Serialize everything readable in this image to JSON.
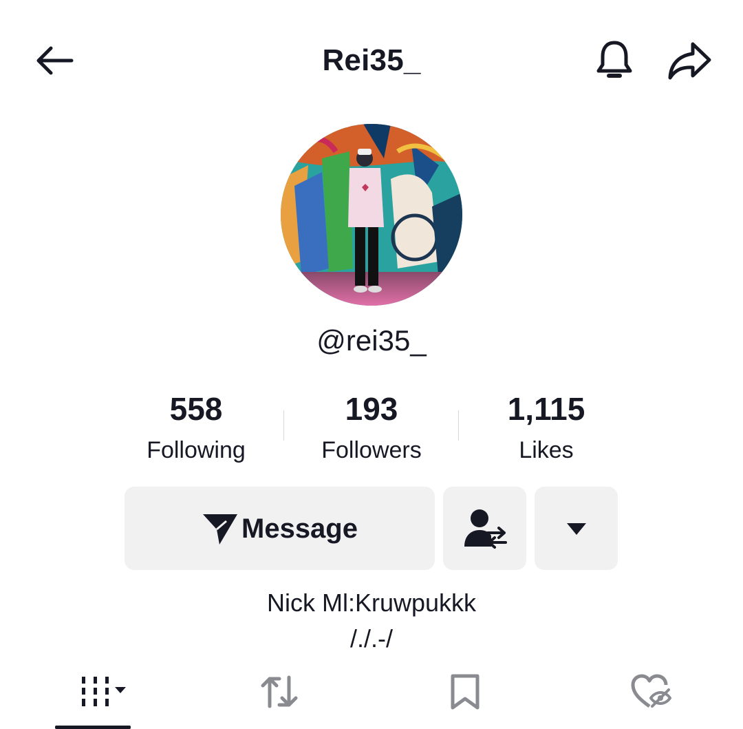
{
  "header": {
    "title": "Rei35_",
    "back_icon": "arrow-left-icon",
    "bell_icon": "bell-icon",
    "share_icon": "share-icon"
  },
  "profile": {
    "avatar": "profile-photo",
    "username": "@rei35_",
    "bio_lines": [
      "Nick Ml:Kruwpukkk",
      "/./.-/"
    ]
  },
  "stats": [
    {
      "value": "558",
      "label": "Following"
    },
    {
      "value": "193",
      "label": "Followers"
    },
    {
      "value": "1,115",
      "label": "Likes"
    }
  ],
  "actions": {
    "message_label": "Message",
    "message_icon": "paper-plane-icon",
    "friend_icon": "user-switch-icon",
    "more_icon": "caret-down-icon"
  },
  "tabs": [
    {
      "icon": "videos-grid-icon",
      "active": true
    },
    {
      "icon": "repost-icon",
      "active": false
    },
    {
      "icon": "bookmark-icon",
      "active": false
    },
    {
      "icon": "liked-hidden-icon",
      "active": false
    }
  ],
  "colors": {
    "text": "#161823",
    "button_bg": "#f1f1f2",
    "divider": "#d8d8dc"
  }
}
